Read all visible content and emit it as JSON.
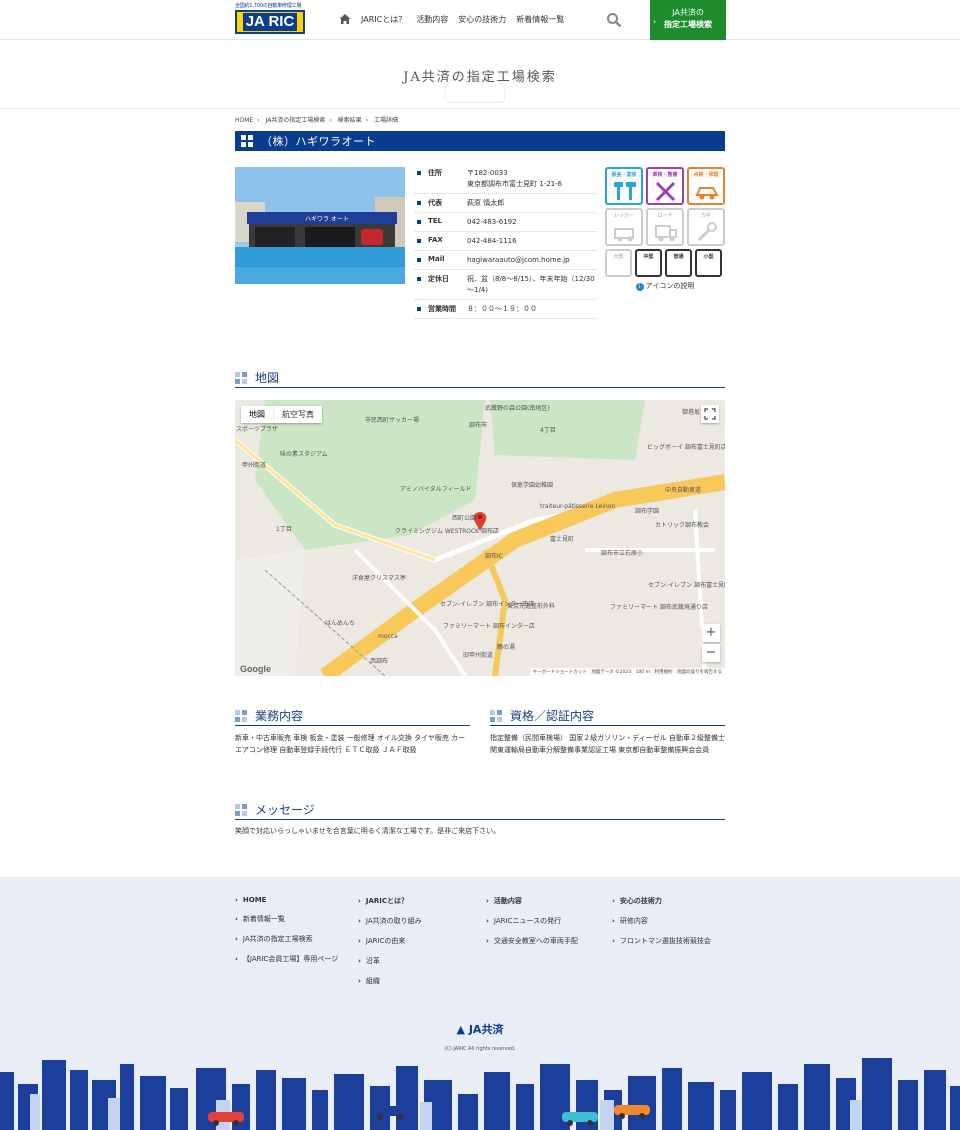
{
  "header": {
    "logo_tagline": "全国約1,700の自動車修理工場",
    "logo_text": "JA RIC",
    "nav": [
      "JARICとは？",
      "活動内容",
      "安心の技術力",
      "新着情報一覧"
    ],
    "cta_line1": "JA共済の",
    "cta_line2": "指定工場検索"
  },
  "hero": {
    "title": "JA共済の指定工場検索"
  },
  "breadcrumb": [
    "HOME",
    "JA共済の指定工場検索",
    "検索結果",
    "工場詳細"
  ],
  "shop": {
    "name": "（株）ハギワラオート",
    "photo_sign": "ハギワラ オート",
    "info": [
      {
        "label": "住所",
        "value": "〒182-0033\n東京都調布市富士見町 1-21-6"
      },
      {
        "label": "代表",
        "value": "萩原 慎太郎"
      },
      {
        "label": "TEL",
        "value": "042-483-6192"
      },
      {
        "label": "FAX",
        "value": "042-484-1116"
      },
      {
        "label": "Mail",
        "value": "hagiwaraauto@jcom.home.jp"
      },
      {
        "label": "定休日",
        "value": "祝、盆（8/8～8/15）、年末年始（12/30～1/4）"
      },
      {
        "label": "営業時間",
        "value": "８：００～１９：００"
      }
    ]
  },
  "services": {
    "row1": [
      "板金・塗装",
      "車検・整備",
      "点検・修理"
    ],
    "row2": [
      "レッカー",
      "ロード",
      "カギ"
    ],
    "row3": [
      "大型",
      "中型",
      "普通",
      "小型"
    ],
    "help": "アイコンの説明",
    "colors": {
      "blue": "#2aa3dd",
      "purple": "#9b3fb5",
      "orange": "#f07f2b",
      "inactive": "#cccccc",
      "active": "#333333"
    }
  },
  "map_section": {
    "title": "地図",
    "tabs": [
      "地図",
      "航空写真"
    ],
    "labels": [
      "武蔵野の森公園(南地区)",
      "御塔坂",
      "市民西町サッカー場",
      "スポーツプラザ",
      "味の素スタジアム",
      "調布市",
      "4丁目",
      "ビッグボーイ 調布富士見町店",
      "甲州街道",
      "アミノバイタルフィールド",
      "保恵学園幼稚園",
      "中央自動車道",
      "traiteur-pâtisserie Leinon",
      "調布学園",
      "カトリック調布教会",
      "クライミングジム WESTROCK 調布店",
      "西町公園",
      "1丁目",
      "富士見町",
      "調布IC",
      "調布市立石原小",
      "洋食屋クリスマス亭",
      "セブン-イレブン 調布富士見町3丁目店",
      "セブン-イレブン 調布インター南店",
      "東京先進整形外科",
      "ファミリーマート 調布武蔵境通り店",
      "ファミリーマート 調布インター店",
      "はんめんち",
      "mocca",
      "西調布",
      "鶴の湯",
      "旧甲州街道"
    ],
    "attribution": "キーボードショートカット　地図データ ©2023　100 m　利用規約　地図の誤りを報告する",
    "google": "Google"
  },
  "business": {
    "title": "業務内容",
    "text": "新車・中古車販売 車検 板金・塗装 一般修理 オイル交換 タイヤ販売 カーエアコン修理 自動車登録手続代行 ＥＴＣ取扱 ＪＡＦ取扱"
  },
  "certs": {
    "title": "資格／認証内容",
    "text": "指定整備（民間車検場） 国家２級ガソリン・ディーゼル 自動車２級整備士 関東運輸局自動車分解整備事業認証工場 東京都自動車整備振興会会員"
  },
  "message": {
    "title": "メッセージ",
    "text": "笑顔で対応いらっしゃいませを合言葉に明るく清潔な工場です。是非ご来店下さい。"
  },
  "footer": {
    "col1": [
      "HOME",
      "新着情報一覧",
      "JA共済の指定工場検索",
      "【JARIC会員工場】専用ページ"
    ],
    "col2": [
      "JARICとは？",
      "JA共済の取り組み",
      "JARICの由来",
      "沿革",
      "組織"
    ],
    "col3": [
      "活動内容",
      "JARICニュースの発行",
      "交通安全教室への車両手配"
    ],
    "col4": [
      "安心の技術力",
      "研修内容",
      "フロントマン選抜技術競技会"
    ],
    "ja_logo": "JA共済",
    "copyright": "(C) JARIC All rights reserved."
  }
}
